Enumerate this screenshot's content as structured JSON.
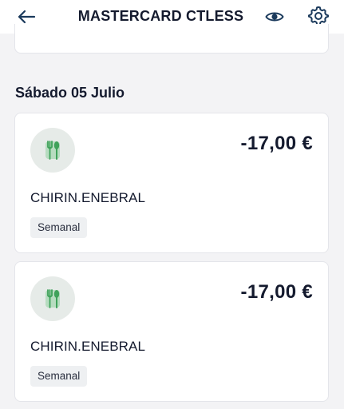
{
  "header": {
    "title": "MASTERCARD CTLESS",
    "back_icon": "arrow-left-icon",
    "visibility_icon": "eye-icon",
    "settings_icon": "gear-icon"
  },
  "colors": {
    "text_primary": "#141a2e",
    "icon_accent": "#1b3a5c",
    "category_green": "#3fa25a",
    "category_bg": "#e6ebe8",
    "tag_bg": "#eef0f2",
    "page_bg": "#f3f3f5"
  },
  "section": {
    "date_label": "Sábado 05 Julio"
  },
  "transactions": [
    {
      "category_icon": "fork-knife-icon",
      "amount": "-17,00 €",
      "merchant": "CHIRIN.ENEBRAL",
      "tag": "Semanal"
    },
    {
      "category_icon": "fork-knife-icon",
      "amount": "-17,00 €",
      "merchant": "CHIRIN.ENEBRAL",
      "tag": "Semanal"
    }
  ]
}
